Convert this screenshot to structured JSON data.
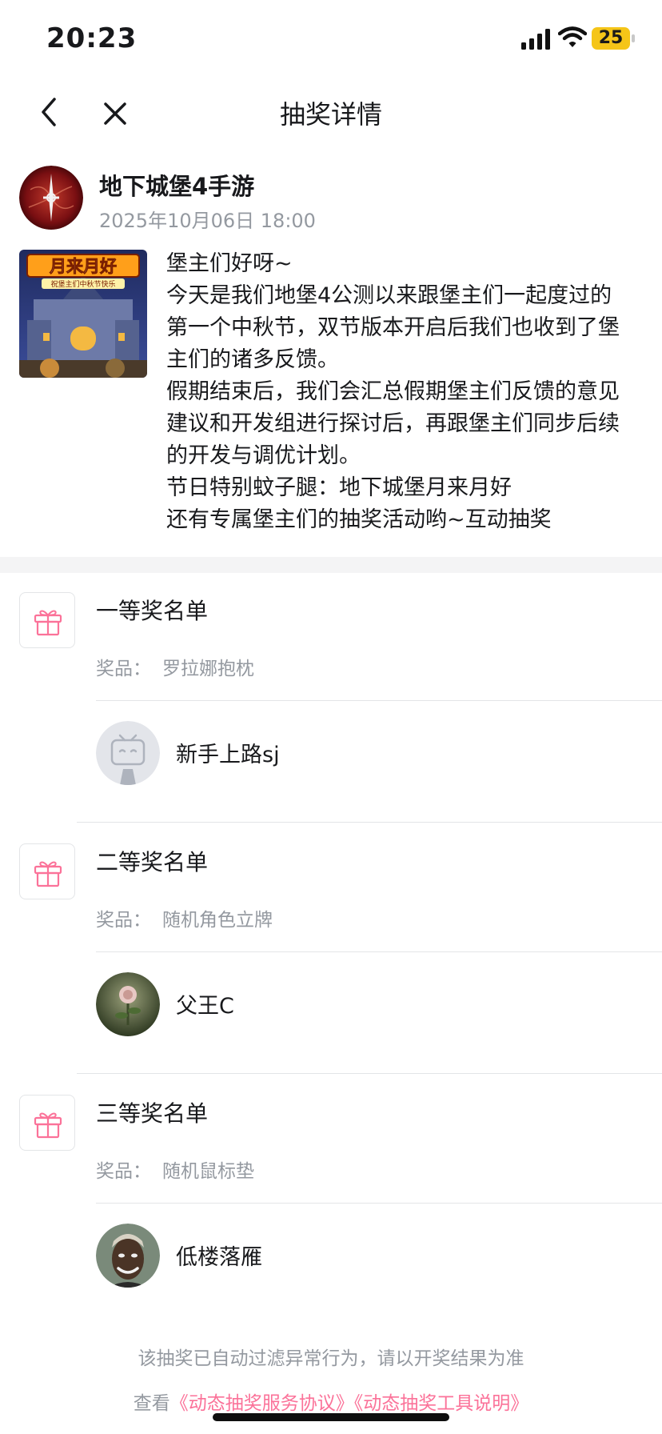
{
  "status_bar": {
    "time": "20:23",
    "battery": "25",
    "battery_color": "#f5c518"
  },
  "nav": {
    "title": "抽奖详情",
    "back_icon": "chevron-left-icon",
    "close_icon": "close-icon"
  },
  "post": {
    "author_name": "地下城堡4手游",
    "timestamp": "2025年10月06日 18:00",
    "image_text": {
      "title": "月来月好",
      "subtitle": "祝堡主们中秋节快乐"
    },
    "lines": [
      "堡主们好呀~",
      "今天是我们地堡4公测以来跟堡主们一起度过的",
      "第一个中秋节，双节版本开启后我们也收到了堡",
      "主们的诸多反馈。",
      "假期结束后，我们会汇总假期堡主们反馈的意见",
      "建议和开发组进行探讨后，再跟堡主们同步后续",
      "的开发与调优计划。",
      "节日特别蚊子腿：地下城堡月来月好",
      "还有专属堡主们的抽奖活动哟~互动抽奖"
    ]
  },
  "prizes": [
    {
      "tier": "一等奖名单",
      "prize_label": "奖品：",
      "prize": "罗拉娜抱枕",
      "winner": "新手上路sj"
    },
    {
      "tier": "二等奖名单",
      "prize_label": "奖品：",
      "prize": "随机角色立牌",
      "winner": "父王C"
    },
    {
      "tier": "三等奖名单",
      "prize_label": "奖品：",
      "prize": "随机鼠标垫",
      "winner": "低楼落雁"
    }
  ],
  "footer": {
    "note": "该抽奖已自动过滤异常行为，请以开奖结果为准",
    "prefix": "查看",
    "link1": "《动态抽奖服务协议》",
    "link2": "《动态抽奖工具说明》"
  },
  "colors": {
    "accent_pink": "#fb7299",
    "text_primary": "#18191c",
    "text_secondary": "#9499a0"
  }
}
